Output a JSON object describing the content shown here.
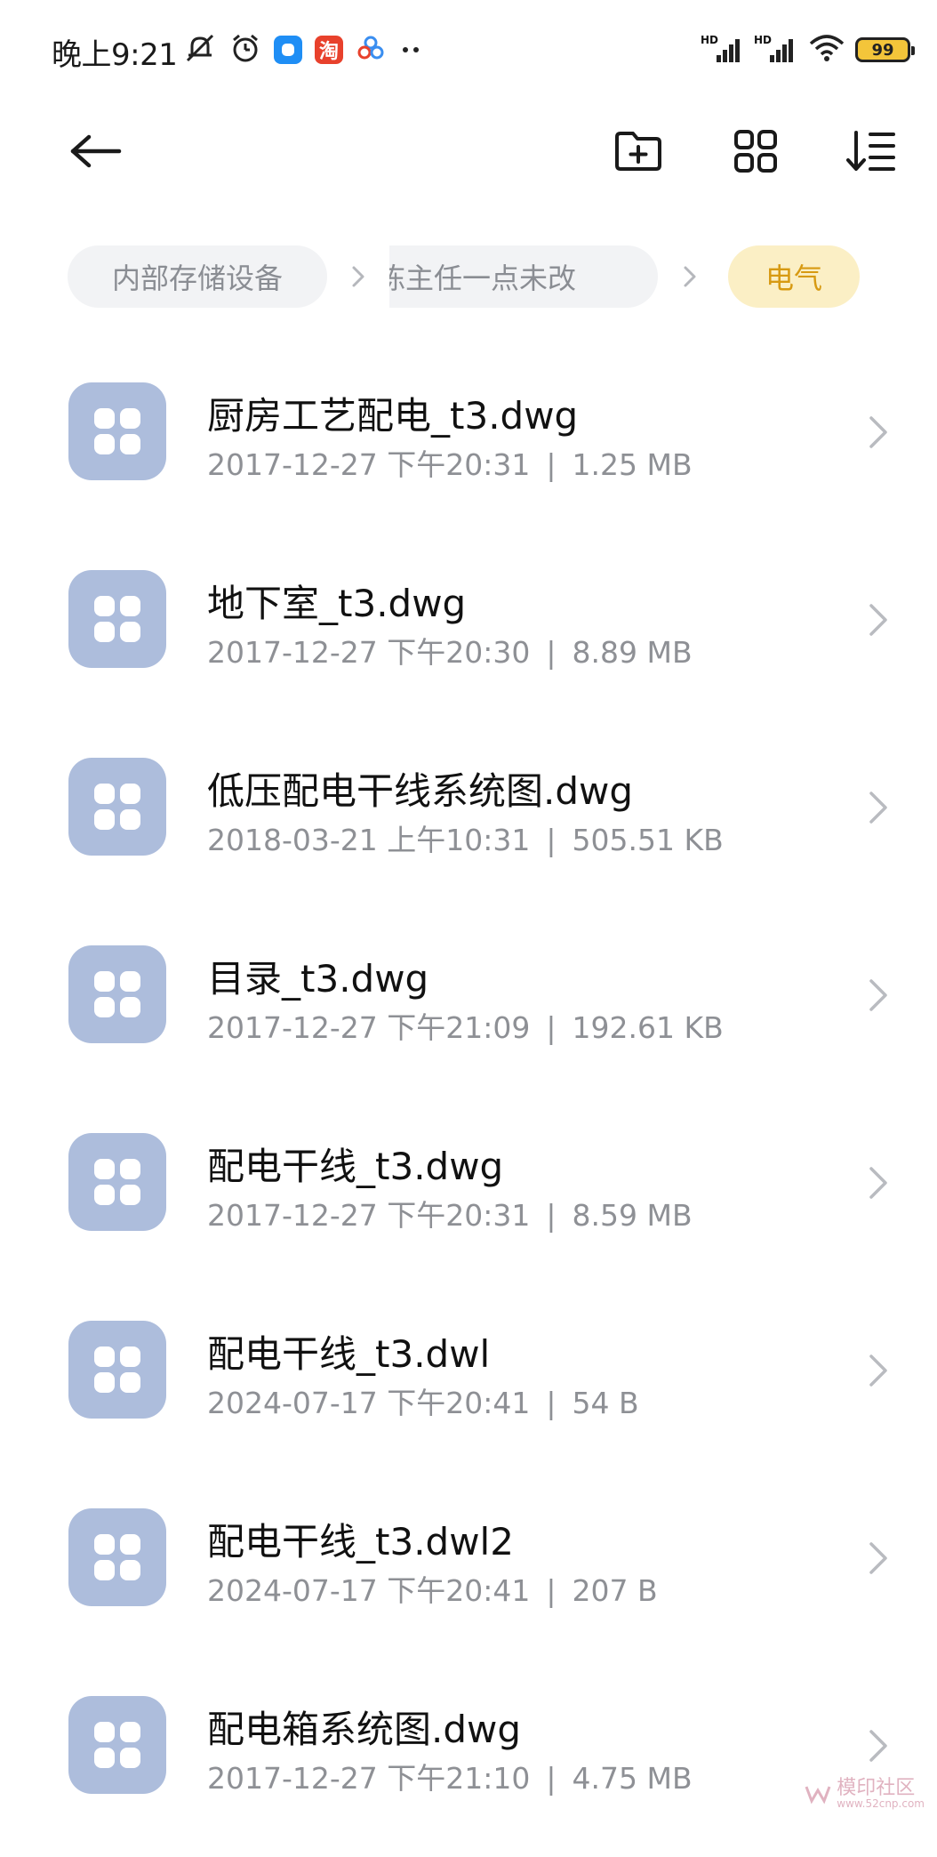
{
  "status_bar": {
    "time": "晚上9:21",
    "left_icons": [
      "mute-alarm-icon",
      "alarm-clock-icon",
      "app-badge-blue-icon",
      "taobao-icon",
      "app-badge-cluster-icon",
      "more-dots-icon"
    ],
    "taobao_glyph": "淘",
    "network_labels": [
      "HD",
      "HD"
    ],
    "battery_level": "99"
  },
  "toolbar": {
    "back_icon": "arrow-left-icon",
    "new_folder_icon": "folder-plus-icon",
    "view_icon": "grid-view-icon",
    "sort_icon": "sort-icon"
  },
  "breadcrumb": {
    "items": [
      {
        "label": "内部存储设备"
      },
      {
        "label": "陈主任一点未改"
      },
      {
        "label": "电气"
      }
    ]
  },
  "files": [
    {
      "name": "厨房工艺配电_t3.dwg",
      "date": "2017-12-27 下午20:31",
      "size": "1.25 MB"
    },
    {
      "name": "地下室_t3.dwg",
      "date": "2017-12-27 下午20:30",
      "size": "8.89 MB"
    },
    {
      "name": "低压配电干线系统图.dwg",
      "date": "2018-03-21 上午10:31",
      "size": "505.51 KB"
    },
    {
      "name": "目录_t3.dwg",
      "date": "2017-12-27 下午21:09",
      "size": "192.61 KB"
    },
    {
      "name": "配电干线_t3.dwg",
      "date": "2017-12-27 下午20:31",
      "size": "8.59 MB"
    },
    {
      "name": "配电干线_t3.dwl",
      "date": "2024-07-17 下午20:41",
      "size": "54 B"
    },
    {
      "name": "配电干线_t3.dwl2",
      "date": "2024-07-17 下午20:41",
      "size": "207 B"
    },
    {
      "name": "配电箱系统图.dwg",
      "date": "2017-12-27 下午21:10",
      "size": "4.75 MB"
    }
  ],
  "meta_separator": "|",
  "colors": {
    "file_icon_bg": "#adbddc",
    "active_crumb_bg": "#fbefc5",
    "active_crumb_text": "#d79a12",
    "inactive_crumb_bg": "#f2f3f5",
    "meta_text": "#8e9095"
  },
  "watermark": {
    "text": "模印社区",
    "url": "www.52cnp.com"
  }
}
